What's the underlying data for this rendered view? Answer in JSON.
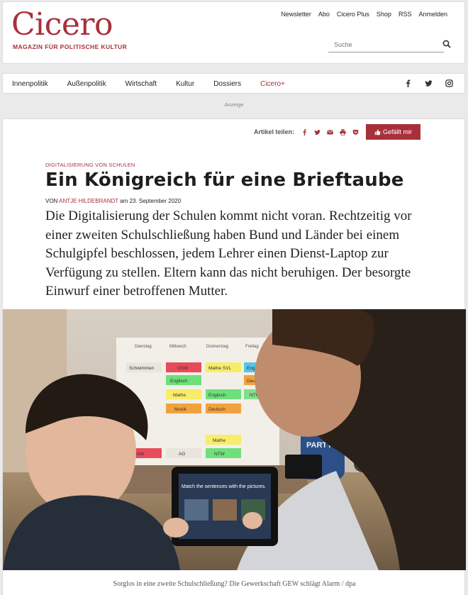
{
  "header": {
    "logo": "Cicero",
    "tagline": "MAGAZIN FÜR POLITISCHE KULTUR",
    "top_links": [
      "Newsletter",
      "Abo",
      "Cicero Plus",
      "Shop",
      "RSS",
      "Anmelden"
    ],
    "search_placeholder": "Suche"
  },
  "nav": {
    "items": [
      "Innenpolitik",
      "Außenpolitik",
      "Wirtschaft",
      "Kultur",
      "Dossiers",
      "Cicero+"
    ],
    "social_icons": [
      "facebook-icon",
      "twitter-icon",
      "instagram-icon"
    ]
  },
  "ad_label": "Anzeige",
  "article": {
    "share_label": "Artikel teilen:",
    "share_icons": [
      "facebook-icon",
      "twitter-icon",
      "mail-icon",
      "print-icon",
      "pocket-icon"
    ],
    "like_label": "Gefällt mir",
    "kicker": "DIGITALISIERUNG VON SCHULEN",
    "title": "Ein Königreich für eine Brieftaube",
    "byline_prefix": "VON",
    "author": "ANTJE HILDEBRANDT",
    "date_text": "am 23. September 2020",
    "teaser": "Die Digitalisierung der Schulen kommt nicht voran. Rechtzeitig vor einer zweiten Schulschließung haben Bund und Länder bei einem Schulgipfel beschlossen, jedem Lehrer einen Dienst-Laptop zur Verfügung zu stellen. Eltern kann das nicht beruhigen. Der besorgte Einwurf einer betroffenen Mutter.",
    "caption": "Sorglos in eine zweite Schulschließung? Die Gewerkschaft GEW schlägt Alarm / dpa",
    "photo": {
      "schedule_headers": [
        "Dienstag",
        "Mittwoch",
        "Donnerstag",
        "Freitag"
      ],
      "schedule_cells": [
        "Schwimmen",
        "GSW",
        "Mathe SVL",
        "Englisch",
        "Englisch",
        "Deutsch",
        "Mathe",
        "Englisch",
        "NTW",
        "Musik",
        "Deutsch",
        "GSW",
        "AG",
        "Mathe",
        "NTW"
      ],
      "tablet_text": "Match the sentences with the pictures.",
      "shirt_text": "PARTY"
    }
  },
  "colors": {
    "brand": "#a8303b"
  }
}
